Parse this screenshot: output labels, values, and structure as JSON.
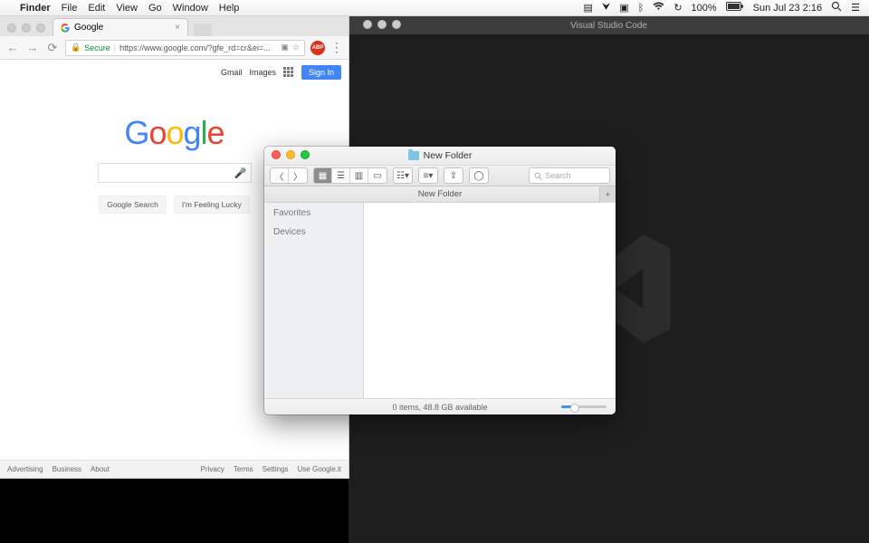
{
  "menubar": {
    "app": "Finder",
    "items": [
      "File",
      "Edit",
      "View",
      "Go",
      "Window",
      "Help"
    ],
    "battery": "100%",
    "datetime": "Sun Jul 23  2:16"
  },
  "chrome": {
    "tab_title": "Google",
    "secure_label": "Secure",
    "url": "https://www.google.com/?gfe_rd=cr&ei=...",
    "toplinks": {
      "gmail": "Gmail",
      "images": "Images",
      "signin": "Sign In"
    },
    "search_btn": "Google Search",
    "lucky_btn": "I'm Feeling Lucky",
    "footer_left": [
      "Advertising",
      "Business",
      "About"
    ],
    "footer_right": [
      "Privacy",
      "Terms",
      "Settings",
      "Use Google.it"
    ]
  },
  "vscode": {
    "title": "Visual Studio Code"
  },
  "finder": {
    "title": "New Folder",
    "path": "New Folder",
    "search_placeholder": "Search",
    "sidebar": {
      "favorites": "Favorites",
      "devices": "Devices"
    },
    "status": "0 items, 48.8 GB available"
  }
}
